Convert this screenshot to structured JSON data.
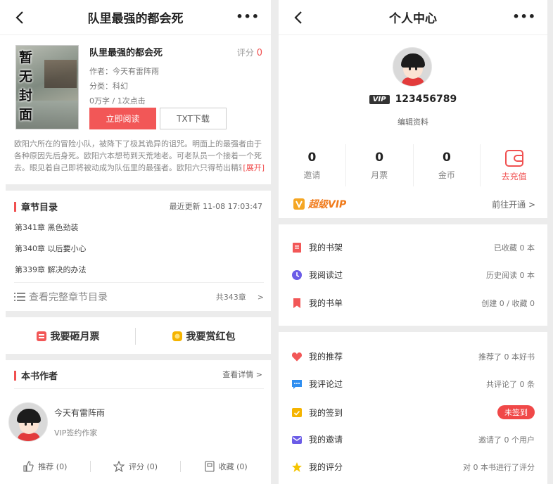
{
  "left": {
    "header": {
      "title": "队里最强的都会死",
      "more": "•••"
    },
    "book": {
      "cover_text": "暂无封面",
      "title": "队里最强的都会死",
      "author": "作者：今天有雷阵雨",
      "category": "分类：科幻",
      "stats": "0万字 / 1次点击",
      "score_label": "评分",
      "score_value": "0",
      "read_button": "立即阅读",
      "txt_button": "TXT下载",
      "description": "欧阳六所在的冒险小队，被降下了极其诡异的诅咒。明面上的最强者由于各种原因先后身死。欧阳六本想苟到天荒地老。可老队员一个接着一个死去。眼见着自己即将被动成为队伍里的最强者。欧阳六只得苟出精彩",
      "expand": "[展开]"
    },
    "chapters": {
      "title": "章节目录",
      "updated": "最近更新 11-08 17:03:47",
      "items": [
        "第341章 黑色劲装",
        "第340章 以后要小心",
        "第339章 解决的办法"
      ],
      "full_catalog": "查看完整章节目录",
      "count": "共343章",
      "arrow": ">"
    },
    "votes": {
      "monthly": "我要砸月票",
      "redpacket": "我要赏红包"
    },
    "author_section": {
      "title": "本书作者",
      "details": "查看详情 >",
      "name": "今天有雷阵雨",
      "role": "VIP签约作家"
    },
    "actions": {
      "recommend": "推荐 (0)",
      "rate": "评分 (0)",
      "collect": "收藏 (0)"
    }
  },
  "right": {
    "header": {
      "title": "个人中心",
      "more": "•••"
    },
    "profile": {
      "vip_tag": "VIP",
      "user_id": "123456789",
      "edit": "编辑资料"
    },
    "stats": [
      {
        "value": "0",
        "label": "邀请"
      },
      {
        "value": "0",
        "label": "月票"
      },
      {
        "value": "0",
        "label": "金币"
      }
    ],
    "recharge": "去充值",
    "super_vip": {
      "label": "超级VIP",
      "action": "前往开通 >"
    },
    "menu1": [
      {
        "label": "我的书架",
        "value": "已收藏 0 本"
      },
      {
        "label": "我阅读过",
        "value": "历史阅读 0 本"
      },
      {
        "label": "我的书单",
        "value": "创建 0 / 收藏 0"
      }
    ],
    "menu2": [
      {
        "label": "我的推荐",
        "value": "推荐了 0 本好书"
      },
      {
        "label": "我评论过",
        "value": "共评论了 0 条"
      },
      {
        "label": "我的签到",
        "value": "未签到"
      },
      {
        "label": "我的邀请",
        "value": "邀请了 0 个用户"
      },
      {
        "label": "我的评分",
        "value": "对 0 本书进行了评分"
      }
    ],
    "colors": {
      "accent": "#f05050",
      "vip": "#f07a1a"
    }
  }
}
